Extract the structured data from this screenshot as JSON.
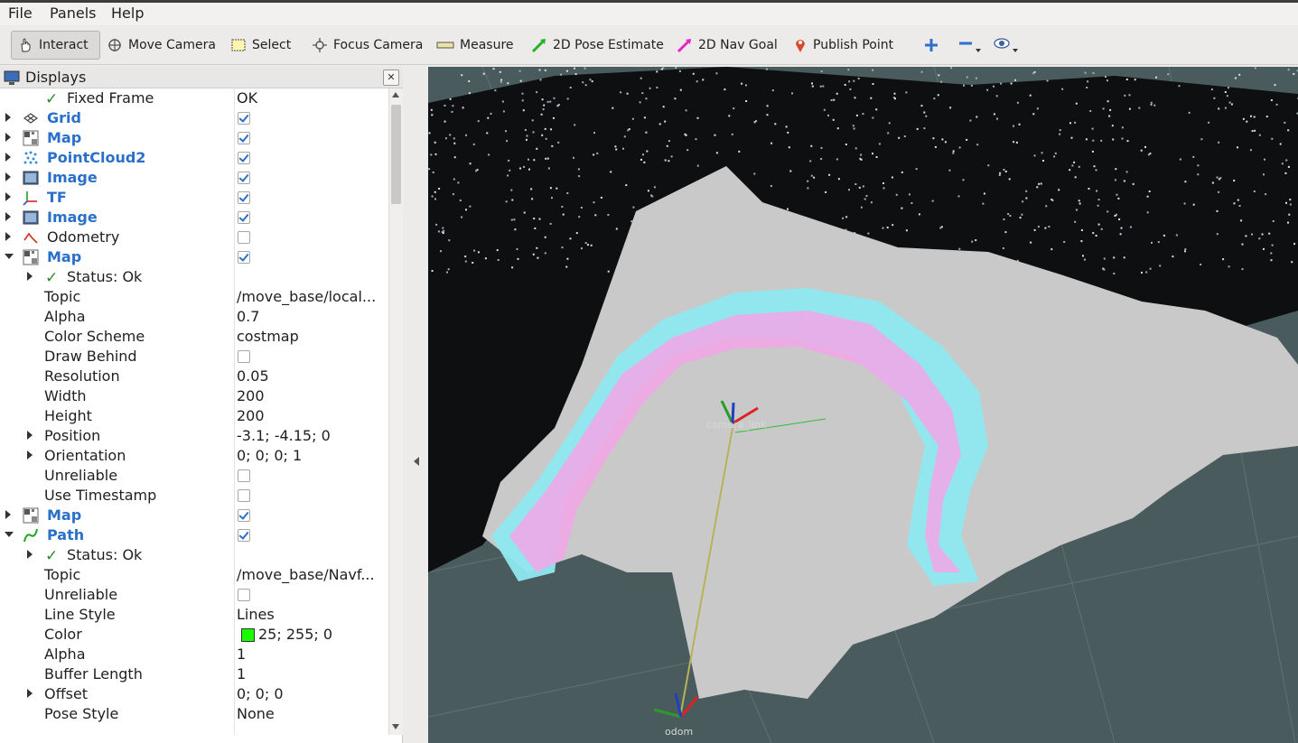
{
  "menubar": {
    "items": [
      {
        "label": "File"
      },
      {
        "label": "Panels"
      },
      {
        "label": "Help"
      }
    ]
  },
  "toolbar": {
    "interact": "Interact",
    "move_camera": "Move Camera",
    "select": "Select",
    "focus_camera": "Focus Camera",
    "measure": "Measure",
    "pose_estimate": "2D Pose Estimate",
    "nav_goal": "2D Nav Goal",
    "publish_point": "Publish Point"
  },
  "displays": {
    "title": "Displays",
    "rows": [
      {
        "name": "Fixed Frame",
        "value": "OK"
      },
      {
        "name": "Grid",
        "checked": true
      },
      {
        "name": "Map",
        "checked": true
      },
      {
        "name": "PointCloud2",
        "checked": true
      },
      {
        "name": "Image",
        "checked": true
      },
      {
        "name": "TF",
        "checked": true
      },
      {
        "name": "Image",
        "checked": true
      },
      {
        "name": "Odometry",
        "checked": false
      },
      {
        "name": "Map",
        "checked": true
      },
      {
        "name": "Status: Ok"
      },
      {
        "name": "Topic",
        "value": "/move_base/local..."
      },
      {
        "name": "Alpha",
        "value": "0.7"
      },
      {
        "name": "Color Scheme",
        "value": "costmap"
      },
      {
        "name": "Draw Behind",
        "checked": false
      },
      {
        "name": "Resolution",
        "value": "0.05"
      },
      {
        "name": "Width",
        "value": "200"
      },
      {
        "name": "Height",
        "value": "200"
      },
      {
        "name": "Position",
        "value": "-3.1; -4.15; 0"
      },
      {
        "name": "Orientation",
        "value": "0; 0; 0; 1"
      },
      {
        "name": "Unreliable",
        "checked": false
      },
      {
        "name": "Use Timestamp",
        "checked": false
      },
      {
        "name": "Map",
        "checked": true
      },
      {
        "name": "Path",
        "checked": true
      },
      {
        "name": "Status: Ok"
      },
      {
        "name": "Topic",
        "value": "/move_base/Navf..."
      },
      {
        "name": "Unreliable",
        "checked": false
      },
      {
        "name": "Line Style",
        "value": "Lines"
      },
      {
        "name": "Color",
        "value": "25; 255; 0",
        "swatch": "#19ff00"
      },
      {
        "name": "Alpha",
        "value": "1"
      },
      {
        "name": "Buffer Length",
        "value": "1"
      },
      {
        "name": "Offset",
        "value": "0; 0; 0"
      },
      {
        "name": "Pose Style",
        "value": "None"
      }
    ]
  },
  "viewport": {
    "frame_label_1": "camera_link",
    "frame_label_2": "odom"
  },
  "colors": {
    "accent": "#2a6fc9",
    "costmap_cyan": "#8fe8ef",
    "costmap_pink": "#f3a6e8"
  }
}
